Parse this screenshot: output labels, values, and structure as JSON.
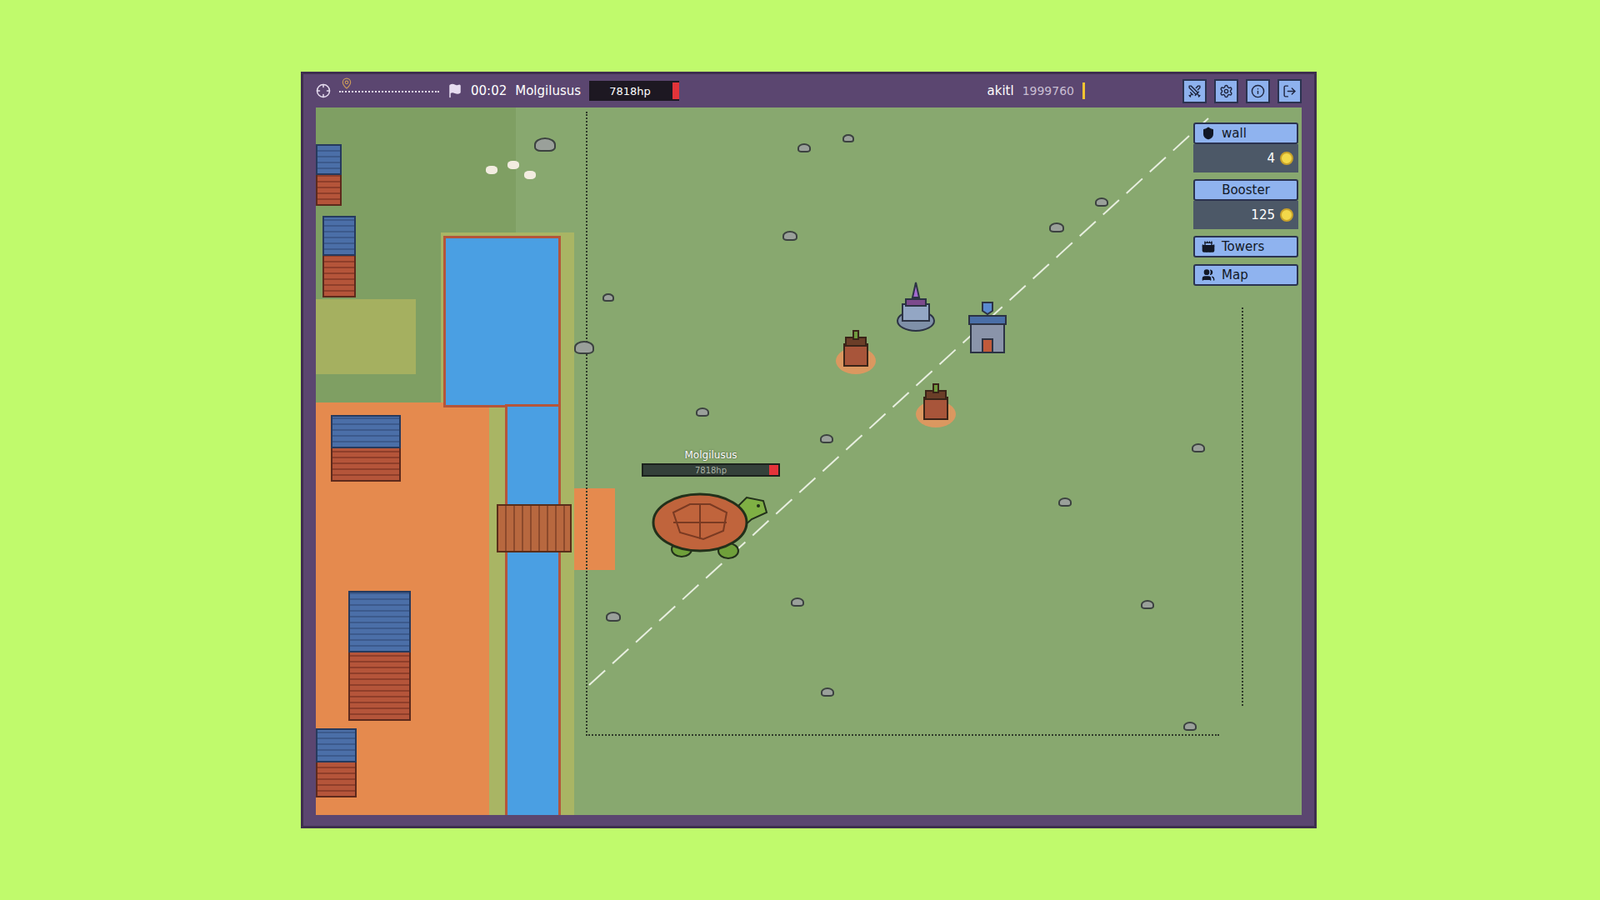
{
  "top_bar": {
    "wave_progress": {
      "level": 0.02
    },
    "timer": "00:02",
    "boss": {
      "name": "Molgilusus",
      "hp": "7818hp",
      "level": 0.07
    },
    "player": {
      "name": "akitl",
      "score": "1999760",
      "energy_level": 0.03
    }
  },
  "shop": [
    {
      "label": "wall",
      "kind": "purchase",
      "price": "4"
    },
    {
      "label": "Booster",
      "kind": "purchase",
      "price": "125"
    },
    {
      "label": "Towers",
      "kind": "menu"
    },
    {
      "label": "Map",
      "kind": "menu"
    }
  ],
  "boss_unit": {
    "name": "Molgilusus",
    "hp": "7818hp",
    "level": 0.07
  },
  "towers": [
    {
      "kind": "crossbow"
    },
    {
      "kind": "mage"
    },
    {
      "kind": "castle"
    },
    {
      "kind": "crossbow"
    }
  ]
}
